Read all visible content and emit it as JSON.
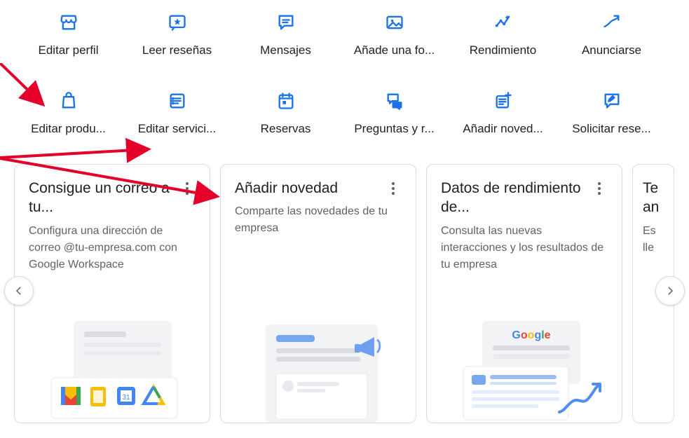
{
  "accent": "#1a73e8",
  "tiles": [
    {
      "id": "edit-profile",
      "label": "Editar perfil",
      "icon": "storefront"
    },
    {
      "id": "read-reviews",
      "label": "Leer reseñas",
      "icon": "review-star"
    },
    {
      "id": "messages",
      "label": "Mensajes",
      "icon": "chat-lines"
    },
    {
      "id": "add-photo",
      "label": "Añade una fo...",
      "icon": "image"
    },
    {
      "id": "performance",
      "label": "Rendimiento",
      "icon": "spark-up"
    },
    {
      "id": "advertise",
      "label": "Anunciarse",
      "icon": "trend-arrow"
    },
    {
      "id": "edit-products",
      "label": "Editar produ...",
      "icon": "shopping-bag"
    },
    {
      "id": "edit-services",
      "label": "Editar servici...",
      "icon": "list-box"
    },
    {
      "id": "bookings",
      "label": "Reservas",
      "icon": "calendar"
    },
    {
      "id": "qna",
      "label": "Preguntas y r...",
      "icon": "qna-bubbles"
    },
    {
      "id": "add-update",
      "label": "Añadir noved...",
      "icon": "post-add"
    },
    {
      "id": "request-reviews",
      "label": "Solicitar rese...",
      "icon": "review-request"
    }
  ],
  "cards": [
    {
      "id": "workspace-email",
      "title": "Consigue un correo a tu...",
      "desc": "Configura una dirección de correo @tu-empresa.com con Google Workspace",
      "illus": "workspace"
    },
    {
      "id": "add-update-card",
      "title": "Añadir novedad",
      "desc": "Comparte las novedades de tu empresa",
      "illus": "megaphone"
    },
    {
      "id": "performance-data",
      "title": "Datos de rendimiento de...",
      "desc": "Consulta las nuevas interacciones y los resultados de tu empresa",
      "illus": "analytics"
    },
    {
      "id": "peek-card",
      "title": "Te an",
      "desc": "Es lle",
      "illus": "none"
    }
  ]
}
